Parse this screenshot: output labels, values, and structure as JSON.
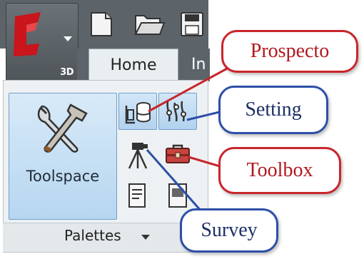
{
  "app_button": {
    "badge": "3D",
    "icon": "autocad-civil-logo-icon"
  },
  "quick_access": [
    {
      "icon": "new-file-icon"
    },
    {
      "icon": "open-folder-icon"
    },
    {
      "icon": "save-icon"
    }
  ],
  "tabs": [
    {
      "label": "Home",
      "active": true
    },
    {
      "label": "In",
      "active": false
    }
  ],
  "panel": {
    "title": "Palettes",
    "large_button": {
      "label": "Toolspace",
      "icon": "toolspace-icon"
    },
    "small_buttons": [
      {
        "icon": "prospector-icon",
        "active": true
      },
      {
        "icon": "settings-icon",
        "active": true
      },
      {
        "icon": "survey-icon",
        "active": false
      },
      {
        "icon": "toolbox-icon",
        "active": false
      },
      {
        "icon": "properties-icon",
        "active": false
      },
      {
        "icon": "panorama-icon",
        "active": false
      }
    ]
  },
  "callouts": {
    "prospector": "Prospecto",
    "setting": "Setting",
    "toolbox": "Toolbox",
    "survey": "Survey"
  },
  "colors": {
    "callout_red": "#c8262c",
    "callout_blue": "#2d4fa8",
    "ribbon_dark": "#5d6469",
    "highlight": "#b6d6f0"
  }
}
